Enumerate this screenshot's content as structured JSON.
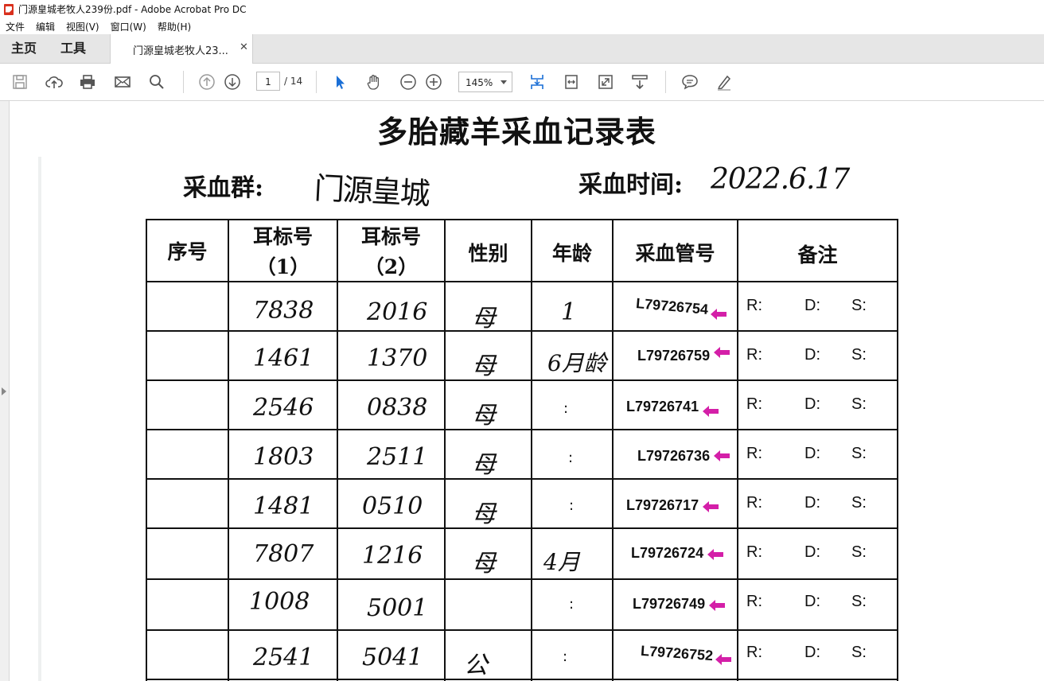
{
  "window": {
    "title": "门源皇城老牧人239份.pdf - Adobe Acrobat Pro DC"
  },
  "menu": [
    "文件",
    "编辑",
    "视图(V)",
    "窗口(W)",
    "帮助(H)"
  ],
  "tabs": {
    "home": "主页",
    "tools": "工具",
    "document": "门源皇城老牧人23..."
  },
  "toolbar": {
    "page_current": "1",
    "page_total": "/ 14",
    "zoom": "145%"
  },
  "document": {
    "title": "多胎藏羊采血记录表",
    "group_label": "采血群:",
    "group_value": "门源皇城",
    "time_label": "采血时间:",
    "time_value": "2022.6.17",
    "headers": {
      "seq": "序号",
      "ear1_a": "耳标号",
      "ear1_b": "（1）",
      "ear2_a": "耳标号",
      "ear2_b": "（2）",
      "sex": "性别",
      "age": "年龄",
      "tube": "采血管号",
      "notes": "备注"
    },
    "rows": [
      {
        "ear1": "7838",
        "ear2": "2016",
        "sex": "母",
        "age": "1",
        "tube": "L79726754",
        "r": "R:",
        "d": "D:",
        "s": "S:"
      },
      {
        "ear1": "1461",
        "ear2": "1370",
        "sex": "母",
        "age": "6月龄",
        "tube": "L79726759",
        "r": "R:",
        "d": "D:",
        "s": "S:"
      },
      {
        "ear1": "2546",
        "ear2": "0838",
        "sex": "母",
        "age": ":",
        "tube": "L79726741",
        "r": "R:",
        "d": "D:",
        "s": "S:"
      },
      {
        "ear1": "1803",
        "ear2": "2511",
        "sex": "母",
        "age": ":",
        "tube": "L79726736",
        "r": "R:",
        "d": "D:",
        "s": "S:"
      },
      {
        "ear1": "1481",
        "ear2": "0510",
        "sex": "母",
        "age": ":",
        "tube": "L79726717",
        "r": "R:",
        "d": "D:",
        "s": "S:"
      },
      {
        "ear1": "7807",
        "ear2": "1216",
        "sex": "母",
        "age": "4月",
        "tube": "L79726724",
        "r": "R:",
        "d": "D:",
        "s": "S:"
      },
      {
        "ear1": "1008",
        "ear2": "5001",
        "sex": "",
        "age": ":",
        "tube": "L79726749",
        "r": "R:",
        "d": "D:",
        "s": "S:"
      },
      {
        "ear1": "2541",
        "ear2": "5041",
        "sex": "公",
        "age": ":",
        "tube": "L79726752",
        "r": "R:",
        "d": "D:",
        "s": "S:"
      }
    ]
  },
  "colors": {
    "flag": "#d41fa8",
    "toolbar_bg": "#ffffff",
    "tabbar_bg": "#e6e6e6",
    "select_tool": "#1a6fd6"
  }
}
